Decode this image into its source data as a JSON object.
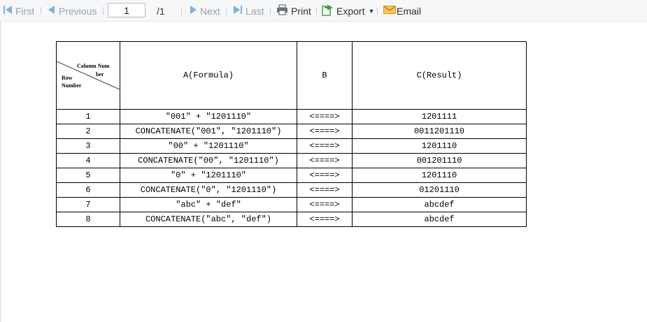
{
  "toolbar": {
    "first_label": "First",
    "previous_label": "Previous",
    "page_value": "1",
    "page_total": "/1",
    "next_label": "Next",
    "last_label": "Last",
    "print_label": "Print",
    "export_label": "Export",
    "email_label": "Email",
    "colors": {
      "nav_disabled": "#9aa3ad",
      "nav_icon": "#7fb0e3",
      "export_icon": "#3ea043",
      "email_icon": "#f0a830"
    }
  },
  "report": {
    "corner": {
      "col_line1": "Column Num",
      "col_line2": "ber",
      "row_line1": "Row",
      "row_line2": "Number"
    },
    "columns": [
      "A(Formula)",
      "B",
      "C(Result)"
    ],
    "rows": [
      {
        "num": "1",
        "a": "\"001\" + \"1201110\"",
        "b": "<====>",
        "c": "1201111"
      },
      {
        "num": "2",
        "a": "CONCATENATE(\"001\", \"1201110\")",
        "b": "<====>",
        "c": "0011201110"
      },
      {
        "num": "3",
        "a": "\"00\" + \"1201110\"",
        "b": "<====>",
        "c": "1201110"
      },
      {
        "num": "4",
        "a": "CONCATENATE(\"00\", \"1201110\")",
        "b": "<====>",
        "c": "001201110"
      },
      {
        "num": "5",
        "a": "\"0\" + \"1201110\"",
        "b": "<====>",
        "c": "1201110"
      },
      {
        "num": "6",
        "a": "CONCATENATE(\"0\", \"1201110\")",
        "b": "<====>",
        "c": "01201110"
      },
      {
        "num": "7",
        "a": "\"abc\" + \"def\"",
        "b": "<====>",
        "c": "abcdef"
      },
      {
        "num": "8",
        "a": "CONCATENATE(\"abc\", \"def\")",
        "b": "<====>",
        "c": "abcdef"
      }
    ]
  }
}
